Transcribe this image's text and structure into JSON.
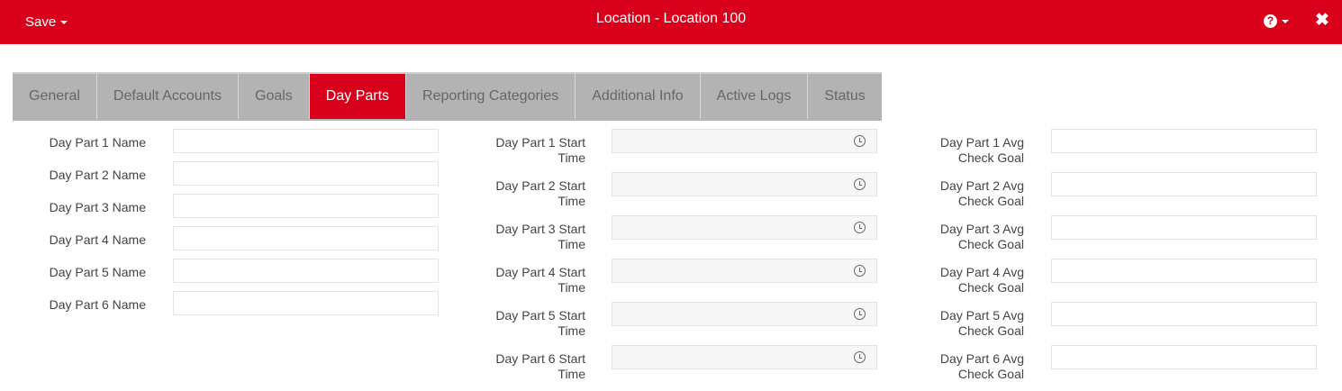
{
  "header": {
    "save_label": "Save",
    "title": "Location - Location 100",
    "help_glyph": "?",
    "close_glyph": "✖"
  },
  "colors": {
    "accent": "#d9001b",
    "tab_bg": "#b3b3b3",
    "tab_text": "#666666"
  },
  "tabs": [
    {
      "label": "General"
    },
    {
      "label": "Default Accounts"
    },
    {
      "label": "Goals"
    },
    {
      "label": "Day Parts",
      "active": true
    },
    {
      "label": "Reporting Categories"
    },
    {
      "label": "Additional Info"
    },
    {
      "label": "Active Logs"
    },
    {
      "label": "Status"
    }
  ],
  "names": [
    {
      "label": "Day Part 1 Name",
      "value": ""
    },
    {
      "label": "Day Part 2 Name",
      "value": ""
    },
    {
      "label": "Day Part 3 Name",
      "value": ""
    },
    {
      "label": "Day Part 4 Name",
      "value": ""
    },
    {
      "label": "Day Part 5 Name",
      "value": ""
    },
    {
      "label": "Day Part 6 Name",
      "value": ""
    }
  ],
  "start_times": [
    {
      "label_line1": "Day Part 1 Start",
      "label_line2": "Time",
      "value": "",
      "icon": "clock-icon"
    },
    {
      "label_line1": "Day Part 2 Start",
      "label_line2": "Time",
      "value": "",
      "icon": "clock-icon"
    },
    {
      "label_line1": "Day Part 3 Start",
      "label_line2": "Time",
      "value": "",
      "icon": "clock-icon"
    },
    {
      "label_line1": "Day Part 4 Start",
      "label_line2": "Time",
      "value": "",
      "icon": "clock-icon"
    },
    {
      "label_line1": "Day Part 5 Start",
      "label_line2": "Time",
      "value": "",
      "icon": "clock-icon"
    },
    {
      "label_line1": "Day Part 6 Start",
      "label_line2": "Time",
      "value": "",
      "icon": "clock-icon"
    }
  ],
  "avg_check_goals": [
    {
      "label_line1": "Day Part 1 Avg",
      "label_line2": "Check Goal",
      "value": ""
    },
    {
      "label_line1": "Day Part 2 Avg",
      "label_line2": "Check Goal",
      "value": ""
    },
    {
      "label_line1": "Day Part 3 Avg",
      "label_line2": "Check Goal",
      "value": ""
    },
    {
      "label_line1": "Day Part 4 Avg",
      "label_line2": "Check Goal",
      "value": ""
    },
    {
      "label_line1": "Day Part 5 Avg",
      "label_line2": "Check Goal",
      "value": ""
    },
    {
      "label_line1": "Day Part 6 Avg",
      "label_line2": "Check Goal",
      "value": ""
    }
  ]
}
